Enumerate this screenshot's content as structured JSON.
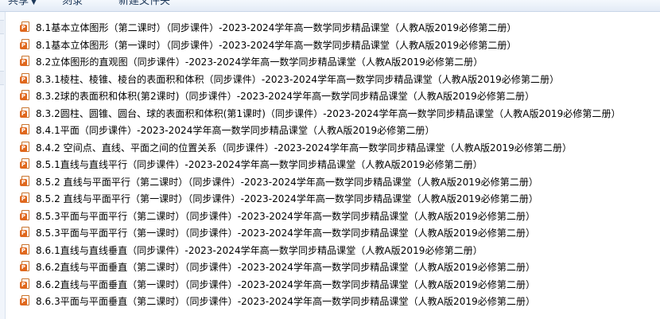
{
  "toolbar": {
    "share_label": "共享",
    "burn_label": "刻录",
    "new_folder_label": "新建文件夹"
  },
  "file_icon": "powerpoint-file-icon",
  "files": [
    "8.1基本立体图形（第二课时）（同步课件）-2023-2024学年高一数学同步精品课堂（人教A版2019必修第二册）",
    "8.1基本立体图形（第一课时）（同步课件）-2023-2024学年高一数学同步精品课堂（人教A版2019必修第二册）",
    "8.2立体图形的直观图（同步课件）-2023-2024学年高一数学同步精品课堂（人教A版2019必修第二册）",
    "8.3.1棱柱、棱锥、棱台的表面积和体积（同步课件）-2023-2024学年高一数学同步精品课堂（人教A版2019必修第二册）",
    "8.3.2球的表面积和体积(第2课时)（同步课件）-2023-2024学年高一数学同步精品课堂（人教A版2019必修第二册）",
    "8.3.2圆柱、圆锥、圆台、球的表面积和体积(第1课时)（同步课件）-2023-2024学年高一数学同步精品课堂（人教A版2019必修第二册）",
    "8.4.1平面（同步课件）-2023-2024学年高一数学同步精品课堂（人教A版2019必修第二册）",
    "8.4.2 空间点、直线、平面之间的位置关系（同步课件）-2023-2024学年高一数学同步精品课堂（人教A版2019必修第二册）",
    "8.5.1直线与直线平行（同步课件）-2023-2024学年高一数学同步精品课堂（人教A版2019必修第二册）",
    "8.5.2 直线与平面平行（第二课时）（同步课件）-2023-2024学年高一数学同步精品课堂（人教A版2019必修第二册）",
    "8.5.2 直线与平面平行（第一课时）（同步课件）-2023-2024学年高一数学同步精品课堂（人教A版2019必修第二册）",
    "8.5.3平面与平面平行（第二课时）（同步课件）-2023-2024学年高一数学同步精品课堂（人教A版2019必修第二册）",
    "8.5.3平面与平面平行（第一课时）（同步课件）-2023-2024学年高一数学同步精品课堂（人教A版2019必修第二册）",
    "8.6.1直线与直线垂直（同步课件）-2023-2024学年高一数学同步精品课堂（人教A版2019必修第二册）",
    "8.6.2直线与平面垂直（第二课时）（同步课件）-2023-2024学年高一数学同步精品课堂（人教A版2019必修第二册）",
    "8.6.2直线与平面垂直（第一课时）（同步课件）-2023-2024学年高一数学同步精品课堂（人教A版2019必修第二册）",
    "8.6.3平面与平面垂直（第二课时）（同步课件）-2023-2024学年高一数学同步精品课堂（人教A版2019必修第二册）"
  ]
}
